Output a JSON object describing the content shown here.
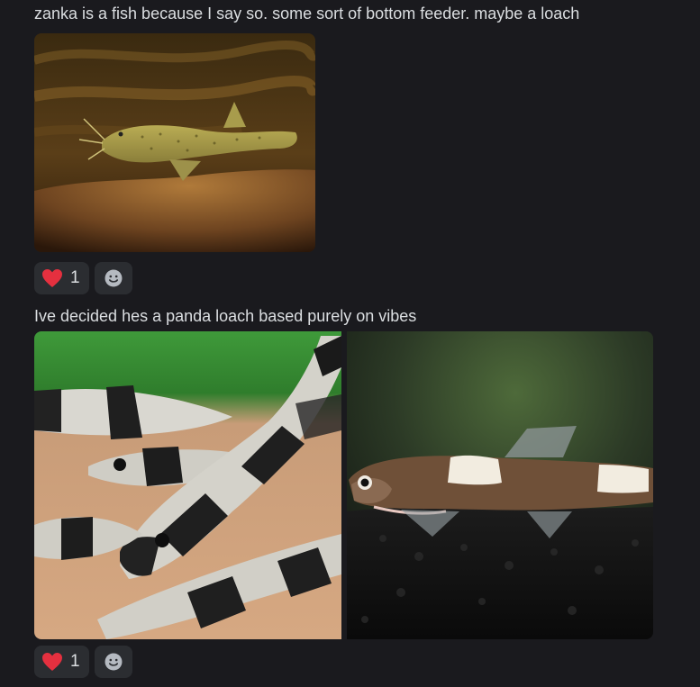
{
  "messages": [
    {
      "text": "zanka is a fish because I say so. some sort of bottom feeder. maybe a loach",
      "reactions": [
        {
          "icon": "heart-icon",
          "emoji_color": "#e5303f",
          "count": "1"
        }
      ],
      "add_reaction_icon": "smile-icon"
    },
    {
      "text": "Ive decided hes a panda loach based purely on vibes",
      "reactions": [
        {
          "icon": "heart-icon",
          "emoji_color": "#e5303f",
          "count": "1"
        }
      ],
      "add_reaction_icon": "smile-icon"
    }
  ],
  "colors": {
    "background": "#1a1a1e",
    "reaction_bg": "#2b2d31",
    "text": "#dbdee1"
  }
}
